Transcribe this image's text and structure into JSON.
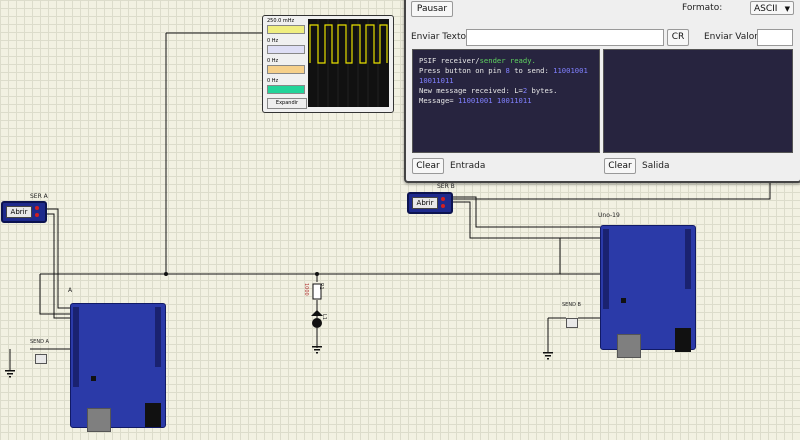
{
  "scope": {
    "channels": [
      {
        "freq": "250.0 mHz",
        "color": "#f0ee80"
      },
      {
        "freq": "0 Hz",
        "color": "#dedef5"
      },
      {
        "freq": "0 Hz",
        "color": "#f6d08a"
      },
      {
        "freq": "0 Hz",
        "color": "#23d49a"
      }
    ],
    "expand_label": "Expandir",
    "trace_color": "#e8e000"
  },
  "serial": {
    "pause_label": "Pausar",
    "format_label": "Formato:",
    "format_value": "ASCII",
    "send_text_label": "Enviar Texto:",
    "cr_label": "CR",
    "send_value_label": "Enviar Valor:",
    "clear_in_label": "Clear",
    "input_title": "Entrada",
    "clear_out_label": "Clear",
    "output_title": "Salida",
    "lines": {
      "l1a": "PSIF receiver/",
      "l1b": "sender ready.",
      "l2a": "Press button on pin ",
      "l2b": "8",
      "l2c": " to send: ",
      "l2d": "11001001",
      "l3": "10011011",
      "l4a": "New message received: L=",
      "l4b": "2",
      "l4c": " bytes.",
      "l5a": "Message= ",
      "l5b": "11001001 10011011"
    }
  },
  "ser_a": {
    "title": "SER A",
    "button": "Abrir"
  },
  "ser_b": {
    "title": "SER B",
    "button": "Abrir"
  },
  "board_a": {
    "label": "A"
  },
  "board_b": {
    "label": "Uno-19"
  },
  "send_a": "SEND A",
  "send_b": "SEND B",
  "resistor": "R1",
  "resistor_value": "1000",
  "led": "L1"
}
